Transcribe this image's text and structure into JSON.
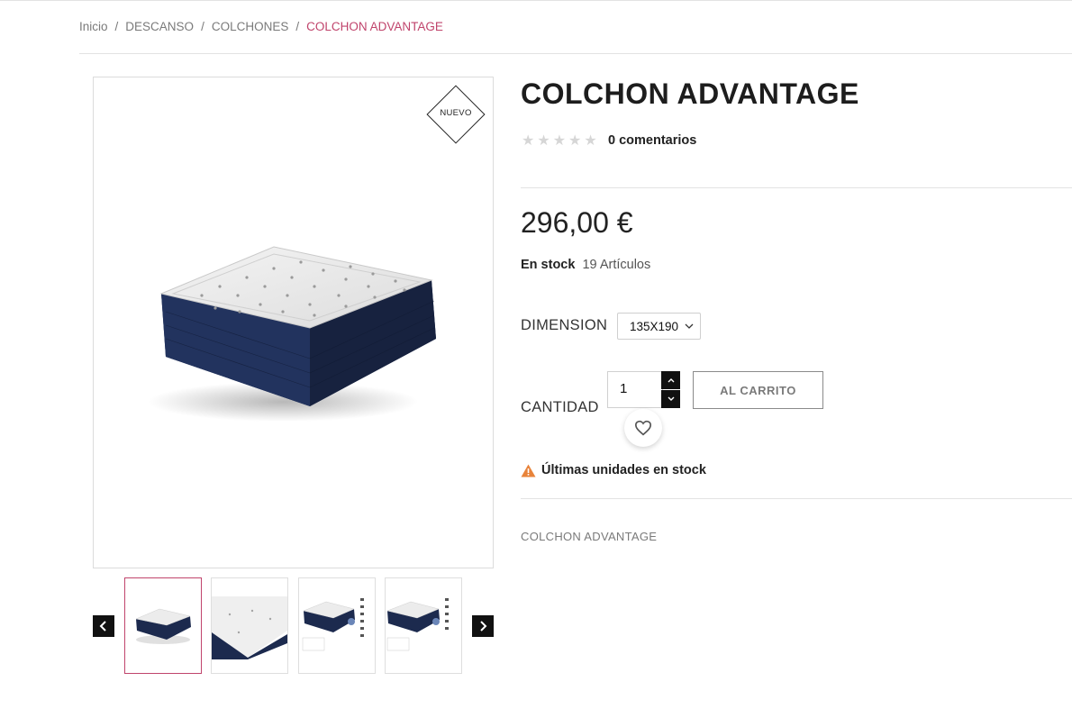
{
  "breadcrumb": {
    "items": [
      "Inicio",
      "DESCANSO",
      "COLCHONES"
    ],
    "current": "COLCHON ADVANTAGE",
    "separator": "/"
  },
  "gallery": {
    "badge": "NUEVO",
    "prev_icon": "chevron-left-icon",
    "next_icon": "chevron-right-icon",
    "thumbnail_count": 4,
    "active_thumbnail": 1
  },
  "product": {
    "title": "COLCHON ADVANTAGE",
    "rating_stars": 0,
    "comments": "0 comentarios",
    "price": "296,00 €",
    "stock_label": "En stock",
    "stock_qty": "19 Artículos",
    "dimension_label": "DIMENSION",
    "dimension_value": "135X190",
    "quantity_label": "CANTIDAD",
    "quantity_value": "1",
    "add_to_cart": "AL CARRITO",
    "alert": "Últimas unidades en stock",
    "description": "COLCHON ADVANTAGE"
  },
  "colors": {
    "accent": "#c0446c",
    "alert_icon": "#e8833a",
    "dark": "#111111"
  }
}
